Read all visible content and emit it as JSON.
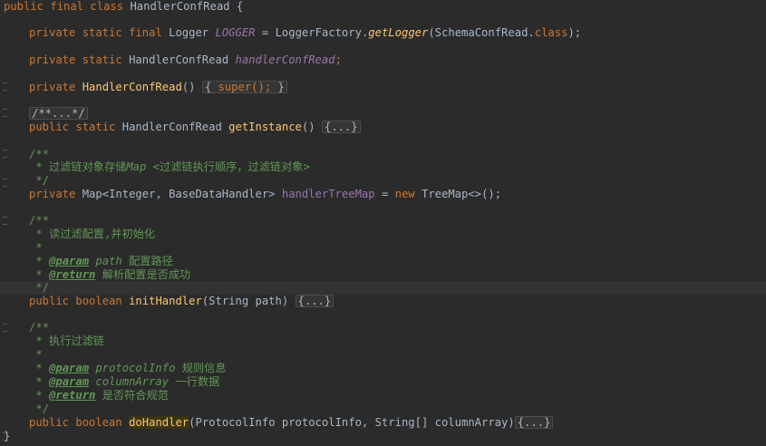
{
  "lines": {
    "l1": {
      "kw_public": "public",
      "kw_final": "final",
      "kw_class": "class",
      "name": "HandlerConfRead",
      "brace": "{"
    },
    "l3": {
      "kw1": "private",
      "kw2": "static",
      "kw3": "final",
      "type": "Logger",
      "field": "LOGGER",
      "eq": "=",
      "factory": "LoggerFactory.",
      "method": "getLogger",
      "args": "(SchemaConfRead.",
      "kw_class": "class",
      "end": ");"
    },
    "l5": {
      "kw1": "private",
      "kw2": "static",
      "type": "HandlerConfRead",
      "field": "handlerConfRead",
      "end": ";"
    },
    "l7": {
      "kw1": "private",
      "ctor": "HandlerConfRead",
      "parens": "()",
      "fold": " super(); "
    },
    "l9": {
      "comment": "/**...*/"
    },
    "l10": {
      "kw1": "public",
      "kw2": "static",
      "type": "HandlerConfRead",
      "method": "getInstance",
      "parens": "()",
      "fold": "{...}"
    },
    "l12": {
      "c1": "/**",
      "c2": " * 过滤链对象存储",
      "c2i": "Map",
      "c2b": " <过滤链执行顺序，过滤链对象>",
      "c3": " */"
    },
    "l15": {
      "kw1": "private",
      "type": "Map<Integer, BaseDataHandler>",
      "field": "handlerTreeMap",
      "eq": "=",
      "kw_new": "new",
      "rest": "TreeMap<>();"
    },
    "l17": {
      "c1": "/**",
      "c2": " * 读过滤配置,并初始化",
      "c3": " *",
      "tag1": "@param",
      "p1": "path",
      "d1": "配置路径",
      "tag2": "@return",
      "d2": "解析配置是否成功",
      "c4": " */"
    },
    "l23": {
      "kw1": "public",
      "kw2": "boolean",
      "method": "initHandler",
      "args": "(String path)",
      "fold": "{...}"
    },
    "l25": {
      "c1": "/**",
      "c2": " * 执行过滤链",
      "c3": " *",
      "tag1": "@param",
      "p1": "protocolInfo",
      "d1": "规则信息",
      "tag2": "@param",
      "p2": "columnArray",
      "d2": "一行数据",
      "tag3": "@return",
      "d3": "是否符合规范",
      "c4": " */"
    },
    "l32": {
      "kw1": "public",
      "kw2": "boolean",
      "method": "doHandler",
      "args": "(ProtocolInfo protocolInfo, String[] columnArray)",
      "fold": "{...}"
    },
    "l33": {
      "brace": "}"
    }
  },
  "icons": {
    "bulb": "lightbulb-icon",
    "fold": "fold-marker-icon"
  },
  "colors": {
    "background": "#2b2b2b",
    "keyword": "#cc7832",
    "field": "#9876aa",
    "method": "#ffc66d",
    "comment": "#629755",
    "text": "#a9b7c6"
  }
}
